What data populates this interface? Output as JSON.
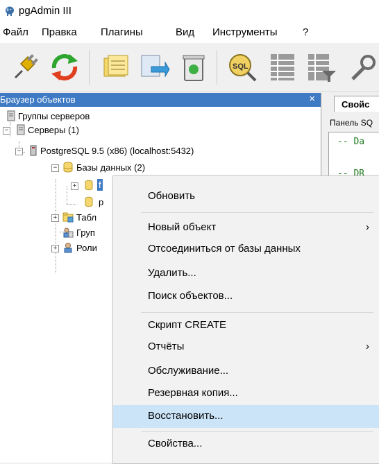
{
  "window": {
    "title": "pgAdmin III",
    "icon": "elephant-icon"
  },
  "menu": {
    "items": [
      "Файл",
      "Правка",
      "Плагины",
      "Вид",
      "Инструменты",
      "?"
    ]
  },
  "toolbar": {
    "buttons": [
      "connect-icon",
      "refresh-icon",
      "properties-icon",
      "create-icon",
      "delete-icon",
      "sql-icon",
      "view-data-icon",
      "filtered-data-icon",
      "maintenance-icon"
    ]
  },
  "object_browser": {
    "title": "Браузер объектов",
    "close": "×",
    "tree": {
      "server_groups": "Группы серверов",
      "servers": "Серверы (1)",
      "postgres": "PostgreSQL 9.5 (x86) (localhost:5432)",
      "databases": "Базы данных (2)",
      "db1": "f",
      "db2": "p",
      "tablespaces": "Табл",
      "group_roles": "Груп",
      "login_roles": "Роли"
    }
  },
  "right_panel": {
    "tab": "Свойс",
    "sql_label": "Панель SQ",
    "sql_lines": [
      "-- Da",
      "-- DR"
    ]
  },
  "context_menu": {
    "items": [
      {
        "label": "Обновить"
      },
      {
        "label": "Новый объект",
        "submenu": "›"
      },
      {
        "label": "Отсоединиться от базы данных"
      },
      {
        "label": "Удалить..."
      },
      {
        "label": "Поиск объектов..."
      },
      {
        "label": "Скрипт CREATE"
      },
      {
        "label": "Отчёты",
        "submenu": "›"
      },
      {
        "label": "Обслуживание..."
      },
      {
        "label": "Резервная копия..."
      },
      {
        "label": "Восстановить...",
        "highlighted": true
      },
      {
        "label": "Свойства..."
      }
    ],
    "highlight_color": "#cce4f7"
  },
  "colors": {
    "panel_header": "#3e7bc4",
    "sql_comment": "#1f7a1f"
  }
}
